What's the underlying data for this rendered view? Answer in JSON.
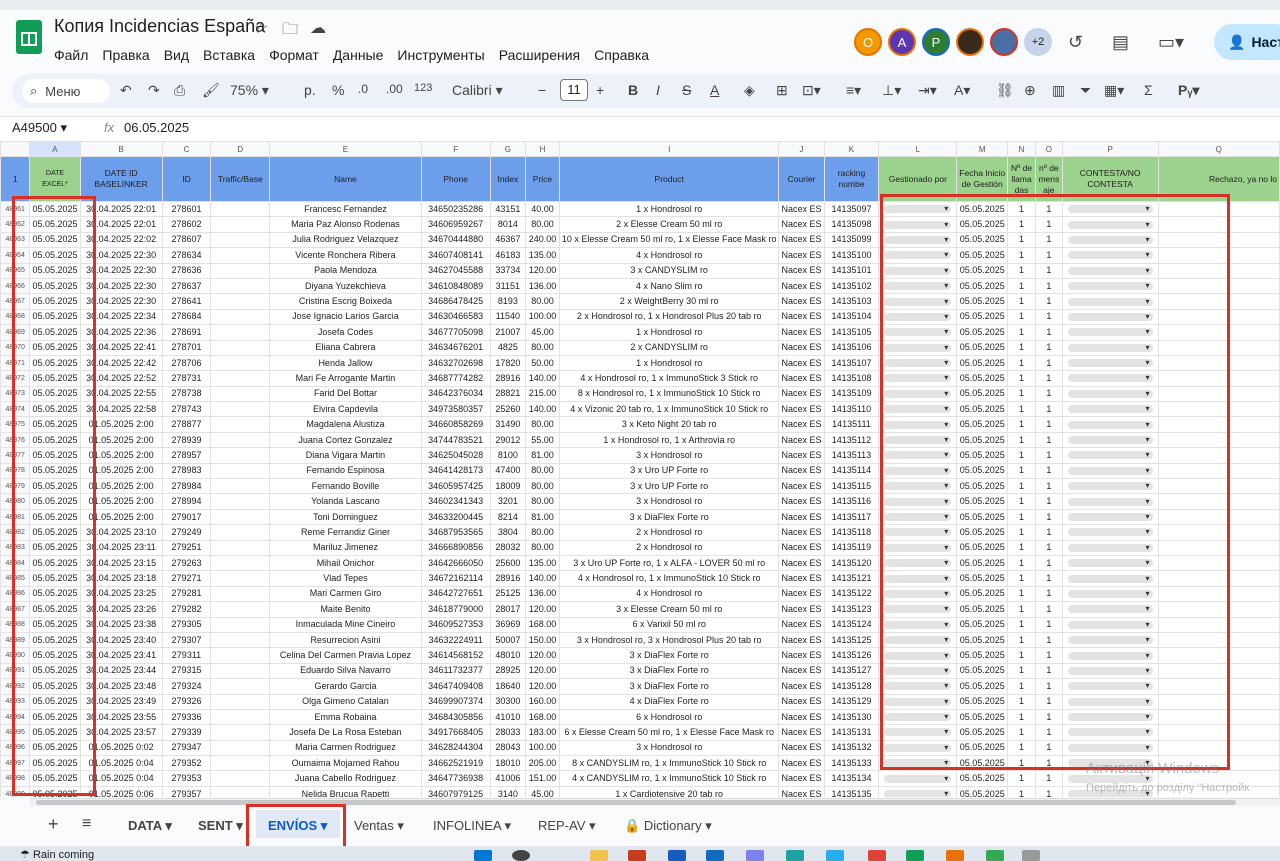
{
  "app": {
    "title": "Копия Incidencias España",
    "menu": [
      "Файл",
      "Правка",
      "Вид",
      "Вставка",
      "Формат",
      "Данные",
      "Инструменты",
      "Расширения",
      "Справка"
    ],
    "avatar_letters": [
      "O",
      "A",
      "P"
    ],
    "avatar_more": "+2",
    "share_label": "Наст"
  },
  "toolbar": {
    "search_label": "Меню",
    "zoom": "75%",
    "currency": "р.",
    "percent": "%",
    "dec_less": ".0",
    "dec_more": ".00",
    "num_format": "123",
    "font": "Calibri",
    "font_size": "11"
  },
  "formula": {
    "cell_ref": "A49500",
    "fx": "fx",
    "value": "06.05.2025"
  },
  "columns": [
    "A",
    "B",
    "C",
    "D",
    "E",
    "F",
    "G",
    "H",
    "I",
    "J",
    "K",
    "L",
    "M",
    "N",
    "O",
    "P",
    "Q"
  ],
  "headers": [
    "DATE EXCEL*",
    "DATE ID BASELINKER",
    "ID",
    "Traffic/Base",
    "Name",
    "Phone",
    "Index",
    "Price",
    "Product",
    "Courier",
    "racking numbe",
    "Gestionado por",
    "Fecha Inicio de Gestión",
    "Nº de llama das",
    "nº de mens aje",
    "CONTESTA/NO CONTESTA",
    "Rechazo, ya no lo"
  ],
  "header_row_number": "1",
  "rows": [
    {
      "n": "48961",
      "a": "05.05.2025",
      "b": "30.04.2025 22:01",
      "c": "278601",
      "e": "Francesc Fernandez",
      "f": "34650235286",
      "g": "43151",
      "h": "40.00",
      "i": "1 x Hondrosol ro",
      "j": "Nacex ES",
      "k": "14135097",
      "m": "05.05.2025",
      "nn": "1",
      "o": "1"
    },
    {
      "n": "48962",
      "a": "05.05.2025",
      "b": "30.04.2025 22:01",
      "c": "278602",
      "e": "Maria Paz Alonso Rodenas",
      "f": "34606959267",
      "g": "8014",
      "h": "80.00",
      "i": "2 x Elesse Cream 50 ml ro",
      "j": "Nacex ES",
      "k": "14135098",
      "m": "05.05.2025",
      "nn": "1",
      "o": "1"
    },
    {
      "n": "48963",
      "a": "05.05.2025",
      "b": "30.04.2025 22:02",
      "c": "278607",
      "e": "Julia Rodriguez Velazquez",
      "f": "34670444880",
      "g": "46367",
      "h": "240.00",
      "i": "10 x Elesse Cream 50 ml ro, 1 x Elesse Face Mask ro",
      "j": "Nacex ES",
      "k": "14135099",
      "m": "05.05.2025",
      "nn": "1",
      "o": "1"
    },
    {
      "n": "48964",
      "a": "05.05.2025",
      "b": "30.04.2025 22:30",
      "c": "278634",
      "e": "Vicente Ronchera Ribera",
      "f": "34607408141",
      "g": "46183",
      "h": "135.00",
      "i": "4 x Hondrosol ro",
      "j": "Nacex ES",
      "k": "14135100",
      "m": "05.05.2025",
      "nn": "1",
      "o": "1"
    },
    {
      "n": "48965",
      "a": "05.05.2025",
      "b": "30.04.2025 22:30",
      "c": "278636",
      "e": "Paola Mendoza",
      "f": "34627045588",
      "g": "33734",
      "h": "120.00",
      "i": "3 x CANDYSLIM ro",
      "j": "Nacex ES",
      "k": "14135101",
      "m": "05.05.2025",
      "nn": "1",
      "o": "1"
    },
    {
      "n": "48966",
      "a": "05.05.2025",
      "b": "30.04.2025 22:30",
      "c": "278637",
      "e": "Diyana Yuzekchieva",
      "f": "34610848089",
      "g": "31151",
      "h": "136.00",
      "i": "4 x Nano Slim ro",
      "j": "Nacex ES",
      "k": "14135102",
      "m": "05.05.2025",
      "nn": "1",
      "o": "1"
    },
    {
      "n": "48967",
      "a": "05.05.2025",
      "b": "30.04.2025 22:30",
      "c": "278641",
      "e": "Cristina Escrig Boixeda",
      "f": "34686478425",
      "g": "8193",
      "h": "80.00",
      "i": "2 x WeightBerry 30 ml ro",
      "j": "Nacex ES",
      "k": "14135103",
      "m": "05.05.2025",
      "nn": "1",
      "o": "1"
    },
    {
      "n": "48968",
      "a": "05.05.2025",
      "b": "30.04.2025 22:34",
      "c": "278684",
      "e": "Jose Ignacio Larios Garcia",
      "f": "34630466583",
      "g": "11540",
      "h": "100.00",
      "i": "2 x Hondrosol ro, 1 x Hondrosol Plus 20 tab ro",
      "j": "Nacex ES",
      "k": "14135104",
      "m": "05.05.2025",
      "nn": "1",
      "o": "1"
    },
    {
      "n": "48969",
      "a": "05.05.2025",
      "b": "30.04.2025 22:36",
      "c": "278691",
      "e": "Josefa Codes",
      "f": "34677705098",
      "g": "21007",
      "h": "45.00",
      "i": "1 x Hondrosol ro",
      "j": "Nacex ES",
      "k": "14135105",
      "m": "05.05.2025",
      "nn": "1",
      "o": "1"
    },
    {
      "n": "48970",
      "a": "05.05.2025",
      "b": "30.04.2025 22:41",
      "c": "278701",
      "e": "Eliana Cabrera",
      "f": "34634676201",
      "g": "4825",
      "h": "80.00",
      "i": "2 x CANDYSLIM ro",
      "j": "Nacex ES",
      "k": "14135106",
      "m": "05.05.2025",
      "nn": "1",
      "o": "1"
    },
    {
      "n": "48971",
      "a": "05.05.2025",
      "b": "30.04.2025 22:42",
      "c": "278706",
      "e": "Henda Jallow",
      "f": "34632702698",
      "g": "17820",
      "h": "50.00",
      "i": "1 x Hondrosol ro",
      "j": "Nacex ES",
      "k": "14135107",
      "m": "05.05.2025",
      "nn": "1",
      "o": "1"
    },
    {
      "n": "48972",
      "a": "05.05.2025",
      "b": "30.04.2025 22:52",
      "c": "278731",
      "e": "Mari Fe Arrogante Martin",
      "f": "34687774282",
      "g": "28916",
      "h": "140.00",
      "i": "4 x Hondrosol ro, 1 x ImmunoStick 3 Stick ro",
      "j": "Nacex ES",
      "k": "14135108",
      "m": "05.05.2025",
      "nn": "1",
      "o": "1"
    },
    {
      "n": "48973",
      "a": "05.05.2025",
      "b": "30.04.2025 22:55",
      "c": "278738",
      "e": "Farid Del Bottar",
      "f": "34642376034",
      "g": "28821",
      "h": "215.00",
      "i": "8 x Hondrosol ro, 1 x ImmunoStick 10 Stick ro",
      "j": "Nacex ES",
      "k": "14135109",
      "m": "05.05.2025",
      "nn": "1",
      "o": "1"
    },
    {
      "n": "48974",
      "a": "05.05.2025",
      "b": "30.04.2025 22:58",
      "c": "278743",
      "e": "Elvira Capdevila",
      "f": "34973580357",
      "g": "25260",
      "h": "140.00",
      "i": "4 x Vizonic 20 tab ro, 1 x ImmunoStick 10 Stick ro",
      "j": "Nacex ES",
      "k": "14135110",
      "m": "05.05.2025",
      "nn": "1",
      "o": "1"
    },
    {
      "n": "48975",
      "a": "05.05.2025",
      "b": "01.05.2025 2:00",
      "c": "278877",
      "e": "Magdalena Alustiza",
      "f": "34660858269",
      "g": "31490",
      "h": "80.00",
      "i": "3 x Keto Night 20 tab ro",
      "j": "Nacex ES",
      "k": "14135111",
      "m": "05.05.2025",
      "nn": "1",
      "o": "1"
    },
    {
      "n": "48976",
      "a": "05.05.2025",
      "b": "01.05.2025 2:00",
      "c": "278939",
      "e": "Juana Cortez Gonzalez",
      "f": "34744783521",
      "g": "29012",
      "h": "55.00",
      "i": "1 x Hondrosol ro, 1 x Arthrovia ro",
      "j": "Nacex ES",
      "k": "14135112",
      "m": "05.05.2025",
      "nn": "1",
      "o": "1"
    },
    {
      "n": "48977",
      "a": "05.05.2025",
      "b": "01.05.2025 2:00",
      "c": "278957",
      "e": "Diana Vigara Martin",
      "f": "34625045028",
      "g": "8100",
      "h": "81.00",
      "i": "3 x Hondrosol ro",
      "j": "Nacex ES",
      "k": "14135113",
      "m": "05.05.2025",
      "nn": "1",
      "o": "1"
    },
    {
      "n": "48978",
      "a": "05.05.2025",
      "b": "01.05.2025 2:00",
      "c": "278983",
      "e": "Fernando Espinosa",
      "f": "34641428173",
      "g": "47400",
      "h": "80.00",
      "i": "3 x Uro UP Forte ro",
      "j": "Nacex ES",
      "k": "14135114",
      "m": "05.05.2025",
      "nn": "1",
      "o": "1"
    },
    {
      "n": "48979",
      "a": "05.05.2025",
      "b": "01.05.2025 2:00",
      "c": "278984",
      "e": "Fernando Boville",
      "f": "34605957425",
      "g": "18009",
      "h": "80.00",
      "i": "3 x Uro UP Forte ro",
      "j": "Nacex ES",
      "k": "14135115",
      "m": "05.05.2025",
      "nn": "1",
      "o": "1"
    },
    {
      "n": "48980",
      "a": "05.05.2025",
      "b": "01.05.2025 2:00",
      "c": "278994",
      "e": "Yolanda Lascano",
      "f": "34602341343",
      "g": "3201",
      "h": "80.00",
      "i": "3 x Hondrosol ro",
      "j": "Nacex ES",
      "k": "14135116",
      "m": "05.05.2025",
      "nn": "1",
      "o": "1"
    },
    {
      "n": "48981",
      "a": "05.05.2025",
      "b": "01.05.2025 2:00",
      "c": "279017",
      "e": "Toni Dominguez",
      "f": "34633200445",
      "g": "8214",
      "h": "81.00",
      "i": "3 x DiaFlex Forte ro",
      "j": "Nacex ES",
      "k": "14135117",
      "m": "05.05.2025",
      "nn": "1",
      "o": "1"
    },
    {
      "n": "48982",
      "a": "05.05.2025",
      "b": "30.04.2025 23:10",
      "c": "279249",
      "e": "Reme Ferrandiz Giner",
      "f": "34687953565",
      "g": "3804",
      "h": "80.00",
      "i": "2 x Hondrosol ro",
      "j": "Nacex ES",
      "k": "14135118",
      "m": "05.05.2025",
      "nn": "1",
      "o": "1"
    },
    {
      "n": "48983",
      "a": "05.05.2025",
      "b": "30.04.2025 23:11",
      "c": "279251",
      "e": "Mariluz Jimenez",
      "f": "34666890856",
      "g": "28032",
      "h": "80.00",
      "i": "2 x Hondrosol ro",
      "j": "Nacex ES",
      "k": "14135119",
      "m": "05.05.2025",
      "nn": "1",
      "o": "1"
    },
    {
      "n": "48984",
      "a": "05.05.2025",
      "b": "30.04.2025 23:15",
      "c": "279263",
      "e": "Mihail Onichor",
      "f": "34642666050",
      "g": "25600",
      "h": "135.00",
      "i": "3 x Uro UP Forte ro, 1 x ALFA - LOVER 50 ml ro",
      "j": "Nacex ES",
      "k": "14135120",
      "m": "05.05.2025",
      "nn": "1",
      "o": "1"
    },
    {
      "n": "48985",
      "a": "05.05.2025",
      "b": "30.04.2025 23:18",
      "c": "279271",
      "e": "Vlad Tepes",
      "f": "34672162114",
      "g": "28916",
      "h": "140.00",
      "i": "4 x Hondrosol ro, 1 x ImmunoStick 10 Stick ro",
      "j": "Nacex ES",
      "k": "14135121",
      "m": "05.05.2025",
      "nn": "1",
      "o": "1"
    },
    {
      "n": "48986",
      "a": "05.05.2025",
      "b": "30.04.2025 23:25",
      "c": "279281",
      "e": "Mari Carmen Giro",
      "f": "34642727651",
      "g": "25125",
      "h": "136.00",
      "i": "4 x Hondrosol ro",
      "j": "Nacex ES",
      "k": "14135122",
      "m": "05.05.2025",
      "nn": "1",
      "o": "1"
    },
    {
      "n": "48987",
      "a": "05.05.2025",
      "b": "30.04.2025 23:26",
      "c": "279282",
      "e": "Maite Benito",
      "f": "34618779000",
      "g": "28017",
      "h": "120.00",
      "i": "3 x Elesse Cream 50 ml ro",
      "j": "Nacex ES",
      "k": "14135123",
      "m": "05.05.2025",
      "nn": "1",
      "o": "1"
    },
    {
      "n": "48988",
      "a": "05.05.2025",
      "b": "30.04.2025 23:38",
      "c": "279305",
      "e": "Inmaculada Mine Cineiro",
      "f": "34609527353",
      "g": "36969",
      "h": "168.00",
      "i": "6 x Varixil 50 ml ro",
      "j": "Nacex ES",
      "k": "14135124",
      "m": "05.05.2025",
      "nn": "1",
      "o": "1"
    },
    {
      "n": "48989",
      "a": "05.05.2025",
      "b": "30.04.2025 23:40",
      "c": "279307",
      "e": "Resurrecion Asini",
      "f": "34632224911",
      "g": "50007",
      "h": "150.00",
      "i": "3 x Hondrosol ro, 3 x Hondrosol Plus 20 tab ro",
      "j": "Nacex ES",
      "k": "14135125",
      "m": "05.05.2025",
      "nn": "1",
      "o": "1"
    },
    {
      "n": "48990",
      "a": "05.05.2025",
      "b": "30.04.2025 23:41",
      "c": "279311",
      "e": "Celina Del Carmen Pravia Lopez",
      "f": "34614568152",
      "g": "48010",
      "h": "120.00",
      "i": "3 x DiaFlex Forte ro",
      "j": "Nacex ES",
      "k": "14135126",
      "m": "05.05.2025",
      "nn": "1",
      "o": "1"
    },
    {
      "n": "48991",
      "a": "05.05.2025",
      "b": "30.04.2025 23:44",
      "c": "279315",
      "e": "Eduardo Silva Navarro",
      "f": "34611732377",
      "g": "28925",
      "h": "120.00",
      "i": "3 x DiaFlex Forte ro",
      "j": "Nacex ES",
      "k": "14135127",
      "m": "05.05.2025",
      "nn": "1",
      "o": "1"
    },
    {
      "n": "48992",
      "a": "05.05.2025",
      "b": "30.04.2025 23:48",
      "c": "279324",
      "e": "Gerardo Garcia",
      "f": "34647409408",
      "g": "18640",
      "h": "120.00",
      "i": "3 x DiaFlex Forte ro",
      "j": "Nacex ES",
      "k": "14135128",
      "m": "05.05.2025",
      "nn": "1",
      "o": "1"
    },
    {
      "n": "48993",
      "a": "05.05.2025",
      "b": "30.04.2025 23:49",
      "c": "279326",
      "e": "Olga Gimeno Catalan",
      "f": "34699907374",
      "g": "30300",
      "h": "160.00",
      "i": "4 x DiaFlex Forte ro",
      "j": "Nacex ES",
      "k": "14135129",
      "m": "05.05.2025",
      "nn": "1",
      "o": "1"
    },
    {
      "n": "48994",
      "a": "05.05.2025",
      "b": "30.04.2025 23:55",
      "c": "279336",
      "e": "Emma Robaina",
      "f": "34684305856",
      "g": "41010",
      "h": "168.00",
      "i": "6 x Hondrosol ro",
      "j": "Nacex ES",
      "k": "14135130",
      "m": "05.05.2025",
      "nn": "1",
      "o": "1"
    },
    {
      "n": "48995",
      "a": "05.05.2025",
      "b": "30.04.2025 23:57",
      "c": "279339",
      "e": "Josefa De La Rosa Esteban",
      "f": "34917668405",
      "g": "28033",
      "h": "183.00",
      "i": "6 x Elesse Cream 50 ml ro, 1 x Elesse Face Mask ro",
      "j": "Nacex ES",
      "k": "14135131",
      "m": "05.05.2025",
      "nn": "1",
      "o": "1"
    },
    {
      "n": "48996",
      "a": "05.05.2025",
      "b": "01.05.2025 0:02",
      "c": "279347",
      "e": "Maria Carmen Rodriguez",
      "f": "34628244304",
      "g": "28043",
      "h": "100.00",
      "i": "3 x Hondrosol ro",
      "j": "Nacex ES",
      "k": "14135132",
      "m": "05.05.2025",
      "nn": "1",
      "o": "1"
    },
    {
      "n": "48997",
      "a": "05.05.2025",
      "b": "01.05.2025 0:04",
      "c": "279352",
      "e": "Oumaima Mojamed Rahou",
      "f": "34662521919",
      "g": "18010",
      "h": "205.00",
      "i": "8 x CANDYSLIM ro, 1 x ImmunoStick 10 Stick ro",
      "j": "Nacex ES",
      "k": "14135133",
      "m": "05.05.2025",
      "nn": "1",
      "o": "1"
    },
    {
      "n": "48998",
      "a": "05.05.2025",
      "b": "01.05.2025 0:04",
      "c": "279353",
      "e": "Juana Cabello Rodriguez",
      "f": "34647736938",
      "g": "41006",
      "h": "151.00",
      "i": "4 x CANDYSLIM ro, 1 x ImmunoStick 10 Stick ro",
      "j": "Nacex ES",
      "k": "14135134",
      "m": "05.05.2025",
      "nn": "1",
      "o": "1"
    },
    {
      "n": "48999",
      "a": "05.05.2025",
      "b": "01.05.2025 0:06",
      "c": "279357",
      "e": "Nelida Brucua Rapetti",
      "f": "34607979125",
      "g": "3140",
      "h": "45.00",
      "i": "1 x Cardiotensive 20 tab ro",
      "j": "Nacex ES",
      "k": "14135135",
      "m": "05.05.2025",
      "nn": "1",
      "o": "1"
    }
  ],
  "sheet_tabs": [
    "DATA",
    "SENT",
    "ENVÍOS",
    "Ventas",
    "INFOLINEA",
    "REP-AV",
    "Dictionary"
  ],
  "active_tab": "ENVÍOS",
  "watermark": {
    "line1": "Активація Windows",
    "line2": "Перейдіть до розділу \"Настройк"
  },
  "taskbar": {
    "weather": "Rain coming"
  },
  "colors": {
    "header_blue": "#6d9eeb",
    "header_green": "#9bd28d",
    "annotation_red": "#d93025",
    "active_tab": "#0b57d0"
  }
}
